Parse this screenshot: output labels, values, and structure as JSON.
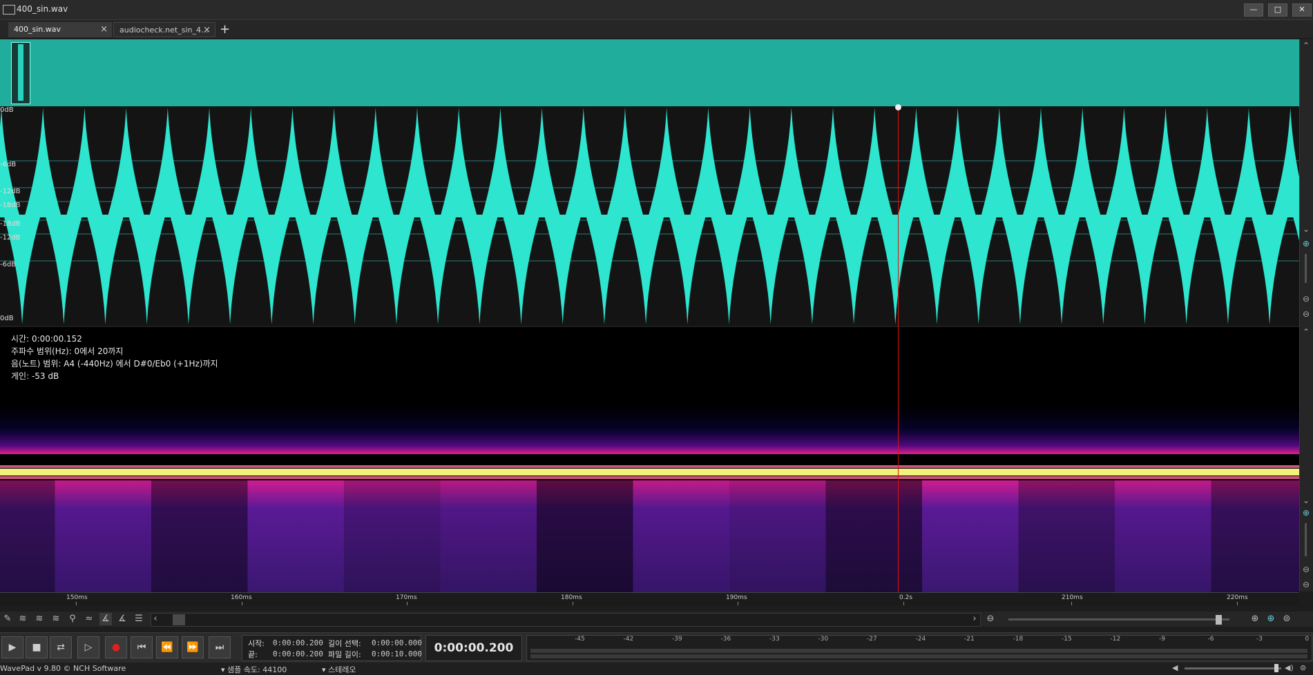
{
  "window": {
    "title": "400_sin.wav",
    "controls": {
      "minimize": "—",
      "maximize": "□",
      "close": "✕"
    }
  },
  "tabs": [
    {
      "label": "400_sin.wav",
      "close": "×"
    },
    {
      "label": "audiocheck.net_sin_4...",
      "close": "×"
    }
  ],
  "add_tab": "+",
  "waveform": {
    "top_labels": [
      "0dB",
      "-6dB",
      "-12dB",
      "-18dB"
    ],
    "bottom_labels": [
      "-18dB",
      "-12dB",
      "-6dB",
      "0dB"
    ],
    "color": "#2ee6cf"
  },
  "spectrogram": {
    "time": "시간: 0:00:00.152",
    "freq_range": "주파수 범위(Hz): 0에서 20까지",
    "note_range": "음(노트) 범위: A4 (-440Hz) 에서 D#0/Eb0  (+1Hz)까지",
    "gain": "게인: -53 dB"
  },
  "ruler": {
    "labels": [
      "150ms",
      "160ms",
      "170ms",
      "180ms",
      "190ms",
      "0.2s",
      "210ms",
      "220ms"
    ]
  },
  "icons": {
    "scroll_left": "‹",
    "scroll_right": "›"
  },
  "selection": {
    "start_label": "시작:",
    "start_value": "0:00:00.200",
    "end_label": "끝:",
    "end_value": "0:00:00.200",
    "sel_len_label": "길이 선택:",
    "sel_len_value": "0:00:00.000",
    "file_len_label": "파일 길이:",
    "file_len_value": "0:00:10.000"
  },
  "current_time": "0:00:00.200",
  "meter_labels": [
    "-45",
    "-42",
    "-39",
    "-36",
    "-33",
    "-30",
    "-27",
    "-24",
    "-21",
    "-18",
    "-15",
    "-12",
    "-9",
    "-6",
    "-3",
    "0"
  ],
  "status": {
    "app": "WavePad v 9.80 © NCH Software",
    "sample_rate": "▾ 샘플 속도: 44100",
    "channels": "▾ 스테레오"
  }
}
